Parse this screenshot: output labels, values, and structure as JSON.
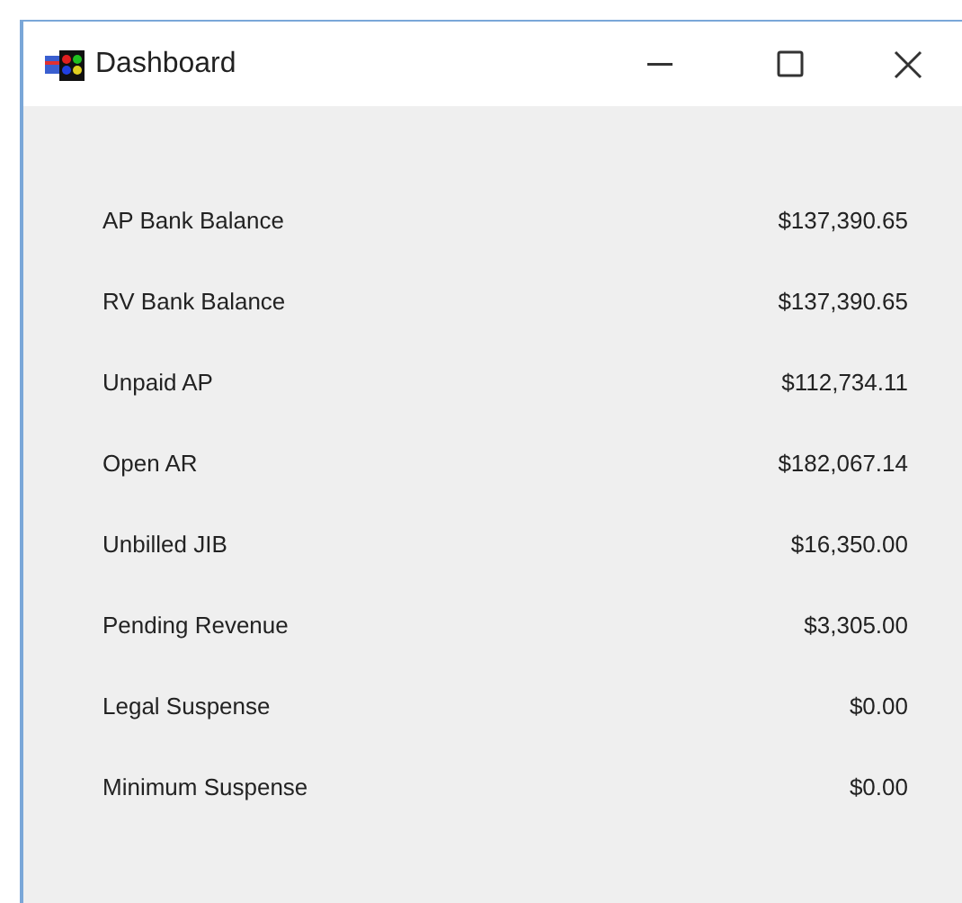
{
  "window": {
    "title": "Dashboard"
  },
  "rows": [
    {
      "label": "AP Bank Balance",
      "value": "$137,390.65"
    },
    {
      "label": "RV Bank Balance",
      "value": "$137,390.65"
    },
    {
      "label": "Unpaid AP",
      "value": "$112,734.11"
    },
    {
      "label": "Open AR",
      "value": "$182,067.14"
    },
    {
      "label": "Unbilled JIB",
      "value": "$16,350.00"
    },
    {
      "label": "Pending Revenue",
      "value": "$3,305.00"
    },
    {
      "label": "Legal Suspense",
      "value": "$0.00"
    },
    {
      "label": "Minimum Suspense",
      "value": "$0.00"
    }
  ]
}
